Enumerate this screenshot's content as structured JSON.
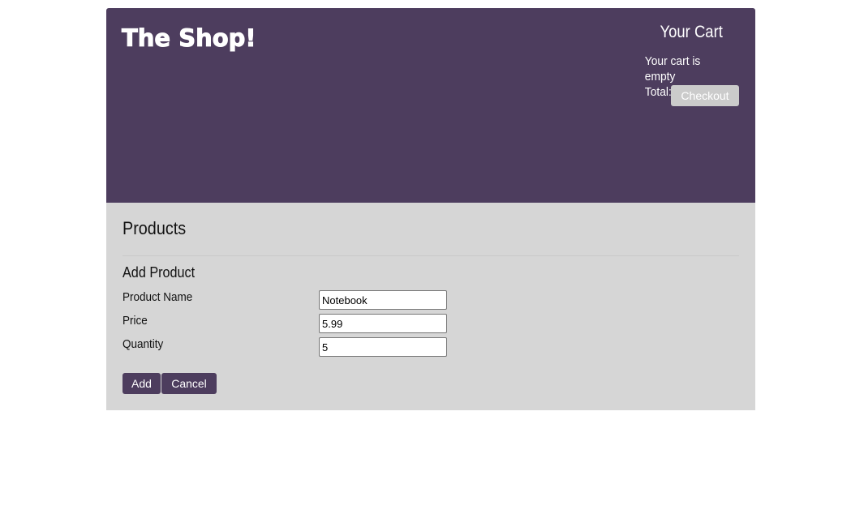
{
  "header": {
    "logo": "The Shop!"
  },
  "cart": {
    "title": "Your Cart",
    "status": "Your cart is empty",
    "total": "Total: $0",
    "checkout_label": "Checkout"
  },
  "products": {
    "title": "Products",
    "form": {
      "title": "Add Product",
      "fields": [
        {
          "label": "Product Name",
          "value": "Notebook"
        },
        {
          "label": "Price",
          "value": "5.99"
        },
        {
          "label": "Quantity",
          "value": "5"
        }
      ],
      "add_label": "Add",
      "cancel_label": "Cancel"
    }
  },
  "colors": {
    "header_bg": "#4d3d5e",
    "products_bg": "#d6d6d6",
    "checkout_bg": "#cbcbcb"
  }
}
